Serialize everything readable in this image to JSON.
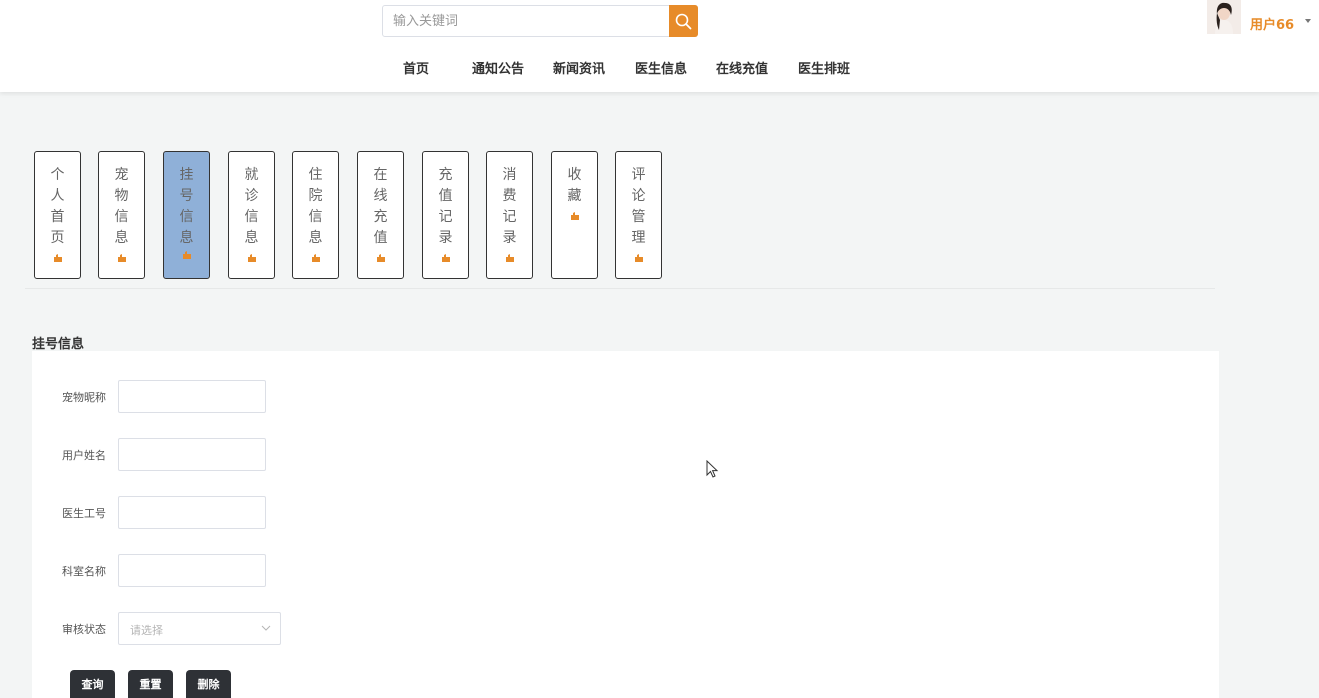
{
  "search": {
    "placeholder": "输入关键词"
  },
  "nav": [
    "首页",
    "通知公告",
    "新闻资讯",
    "医生信息",
    "在线充值",
    "医生排班"
  ],
  "user": {
    "name": "用户66"
  },
  "tabs": [
    "个人首页",
    "宠物信息",
    "挂号信息",
    "就诊信息",
    "住院信息",
    "在线充值",
    "充值记录",
    "消费记录",
    "收藏",
    "评论管理"
  ],
  "active_tab": "挂号信息",
  "section": {
    "title": "挂号信息"
  },
  "form": {
    "pet_nickname": {
      "label": "宠物昵称",
      "value": ""
    },
    "user_name": {
      "label": "用户姓名",
      "value": ""
    },
    "doctor_id": {
      "label": "医生工号",
      "value": ""
    },
    "department": {
      "label": "科室名称",
      "value": ""
    },
    "review_status": {
      "label": "审核状态",
      "placeholder": "请选择"
    }
  },
  "buttons": {
    "query": "查询",
    "reset": "重置",
    "delete": "删除"
  },
  "colors": {
    "accent": "#e78b29",
    "active_tab_bg": "#8fb0d8",
    "button_bg": "#2e3136"
  }
}
